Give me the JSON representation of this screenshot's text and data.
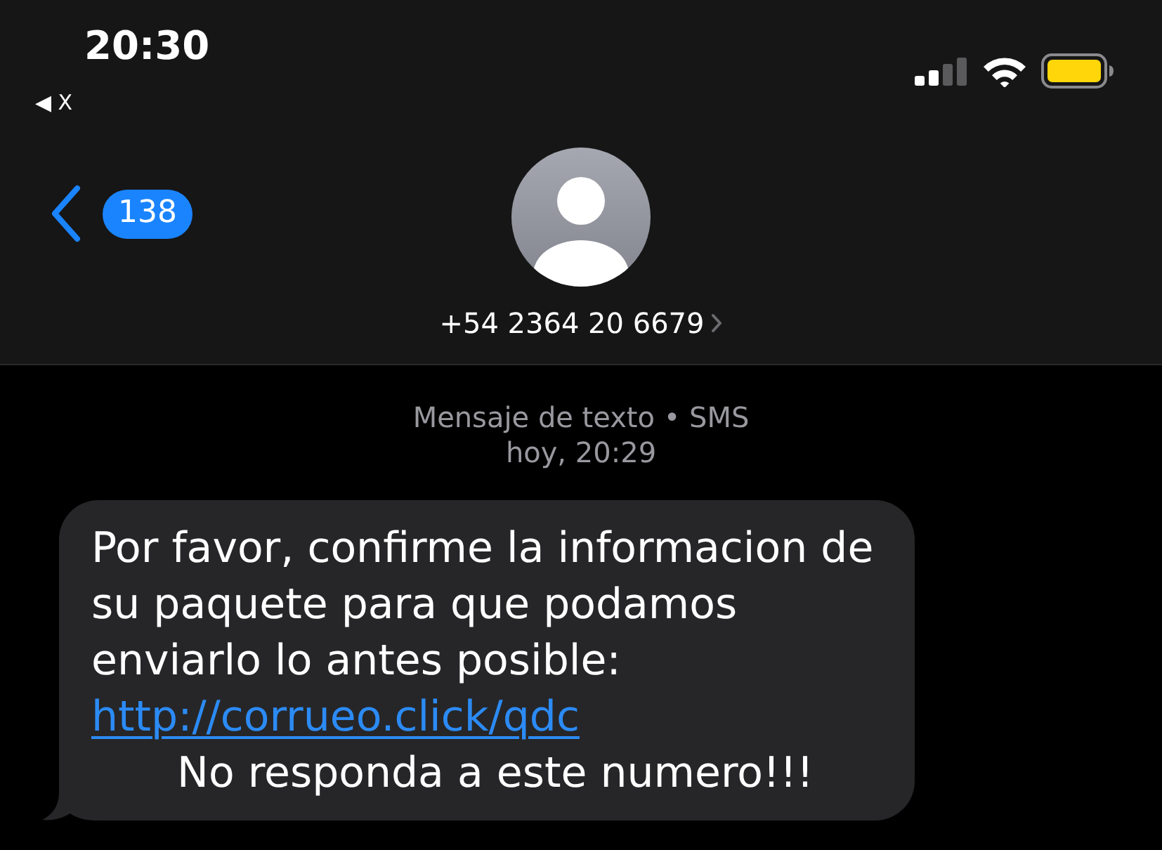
{
  "status_bar": {
    "time": "20:30",
    "return_app": "◀ X"
  },
  "nav": {
    "back_badge": "138",
    "contact": "+54 2364 20 6679"
  },
  "thread_info": {
    "service": "Mensaje de texto • SMS",
    "timestamp": "hoy, 20:29"
  },
  "messages": [
    {
      "kind": "received",
      "text": "Por favor, confirme la informacion de su paquete para que podamos enviarlo lo antes posible:",
      "link": "http://corrueo.click/qdc",
      "closing": "No responda a este numero!!!"
    }
  ]
}
